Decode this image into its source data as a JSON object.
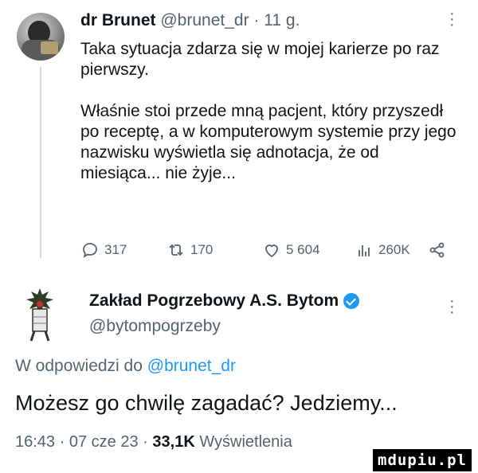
{
  "tweet": {
    "author_name": "dr Brunet",
    "handle": "@brunet_dr",
    "separator": "·",
    "time_ago": "11 g.",
    "paragraphs": [
      "Taka sytuacja zdarza się w mojej karierze po raz pierwszy.",
      "Właśnie stoi przede mną pacjent, który przyszedł po receptę, a w komputerowym systemie przy jego nazwisku wyświetla się adnotacja, że od miesiąca... nie żyje..."
    ],
    "actions": {
      "replies": "317",
      "retweets": "170",
      "likes": "5 604",
      "views": "260K"
    }
  },
  "reply": {
    "author_name": "Zakład Pogrzebowy A.S. Bytom",
    "handle": "@bytompogrzeby",
    "replying_to_prefix": "W odpowiedzi do",
    "replying_to_mention": "@brunet_dr",
    "text": "Możesz go chwilę zagadać? Jedziemy...",
    "time": "16:43",
    "date": "07 cze 23",
    "views_count": "33,1K",
    "views_label": "Wyświetlenia"
  },
  "watermark": "mdupiu.pl",
  "colors": {
    "text": "#0f1419",
    "muted": "#536471",
    "accent": "#1d9bf0"
  }
}
